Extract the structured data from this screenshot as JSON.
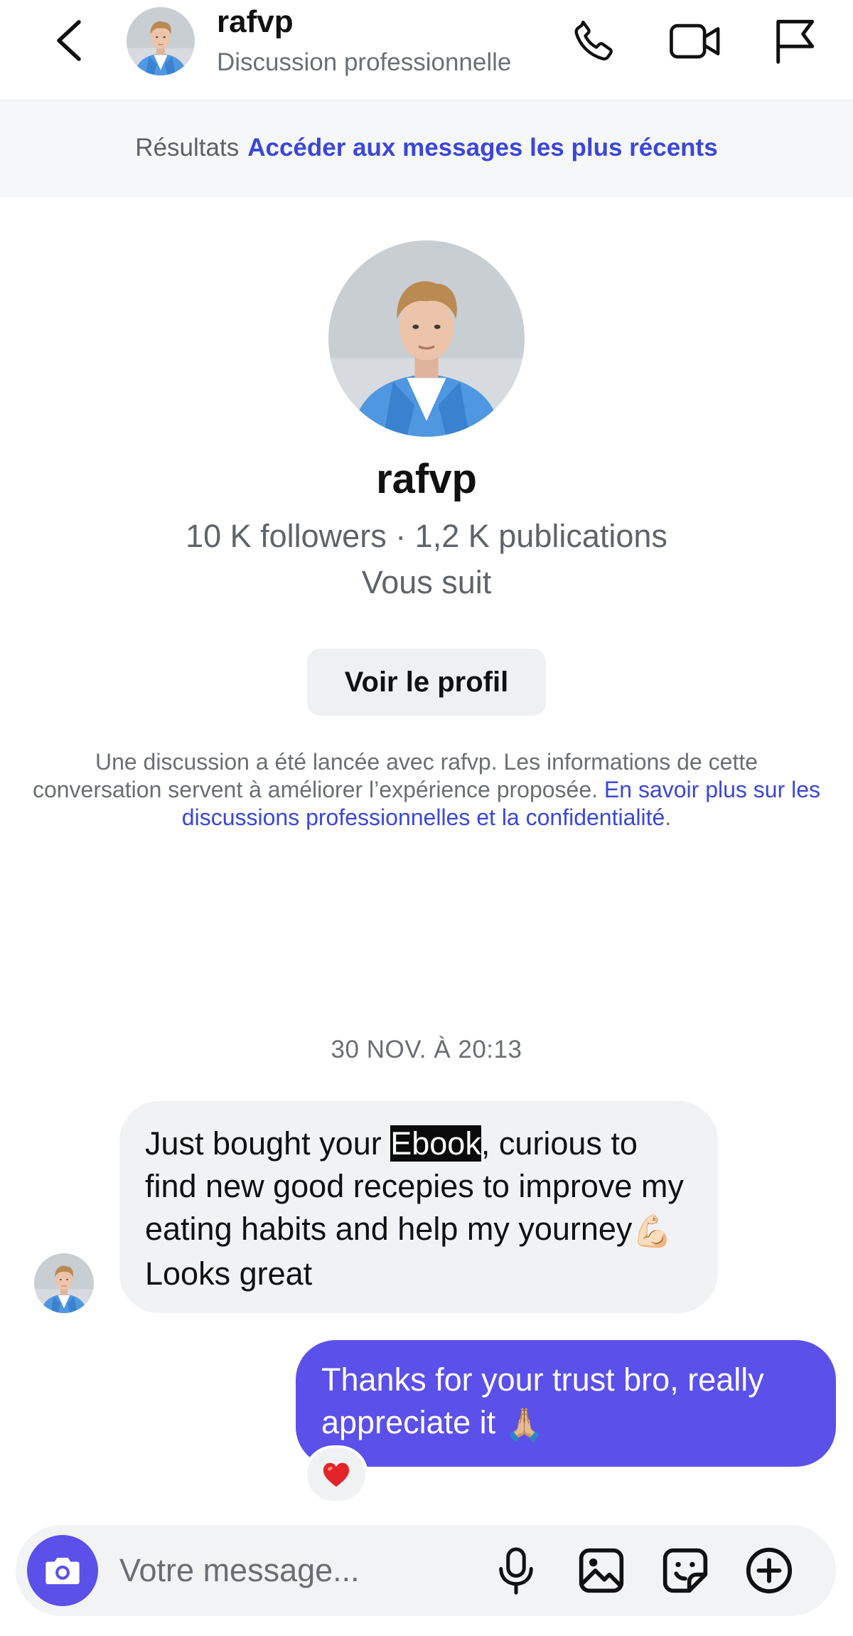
{
  "header": {
    "name": "rafvp",
    "subtitle": "Discussion professionnelle",
    "icons": [
      "chevron-left-icon",
      "phone-icon",
      "video-camera-icon",
      "flag-icon"
    ]
  },
  "banner": {
    "prefix": "Résultats",
    "link": "Accéder aux messages les plus récents"
  },
  "profile": {
    "name": "rafvp",
    "stats": "10 K followers · 1,2 K publications",
    "follow_status": "Vous suit",
    "view_profile_label": "Voir le profil"
  },
  "disclaimer": {
    "text": "Une discussion a été lancée avec rafvp. Les informations de cette conversation servent à améliorer l’expérience proposée.",
    "link": "En savoir plus sur les discussions professionnelles et la confidentialité",
    "end": "."
  },
  "conversation": {
    "date": "30 NOV. À 20:13",
    "incoming": {
      "before": "Just bought your ",
      "highlight": "Ebook",
      "after": ", curious to find new good recepies to improve my eating habits and help my yourney",
      "emoji": "💪🏻",
      "end": " Looks great"
    },
    "outgoing": {
      "text": "Thanks for your trust bro, really appreciate it ",
      "emoji": "🙏🏼",
      "reaction": "❤️"
    }
  },
  "composer": {
    "placeholder": "Votre message...",
    "icons": [
      "camera-icon",
      "microphone-icon",
      "image-icon",
      "sticker-icon",
      "plus-circle-icon"
    ]
  },
  "colors": {
    "accent": "#5b50ea",
    "link": "#3b47d8",
    "bubble_in": "#f1f2f4",
    "banner_bg": "#f6f7f8"
  }
}
